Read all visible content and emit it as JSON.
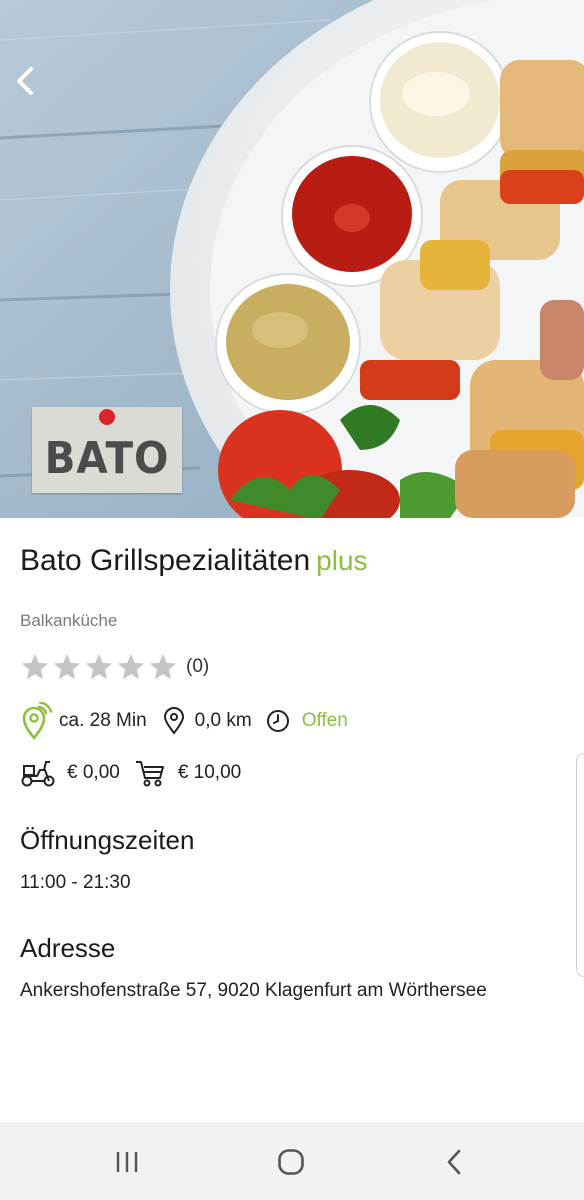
{
  "header": {
    "back_icon": "chevron-left-icon",
    "logo_text": "BATO"
  },
  "restaurant": {
    "name": "Bato Grillspezialitäten",
    "badge": "plus",
    "cuisine": "Balkanküche",
    "rating_count": "(0)",
    "stars_filled": 0,
    "stars_total": 5
  },
  "info": {
    "delivery_time": "ca. 28 Min",
    "distance": "0,0 km",
    "status": "Offen",
    "delivery_fee": "€ 0,00",
    "min_order": "€ 10,00"
  },
  "hours": {
    "heading": "Öffnungszeiten",
    "value": "11:00 - 21:30"
  },
  "address": {
    "heading": "Adresse",
    "value": "Ankershofenstraße 57, 9020 Klagenfurt am Wörthersee"
  },
  "colors": {
    "accent": "#8cbf3f",
    "star": "#c4c4c4"
  },
  "navbar": {
    "recent_icon": "recent-apps-icon",
    "home_icon": "home-icon",
    "back_icon": "back-icon"
  }
}
